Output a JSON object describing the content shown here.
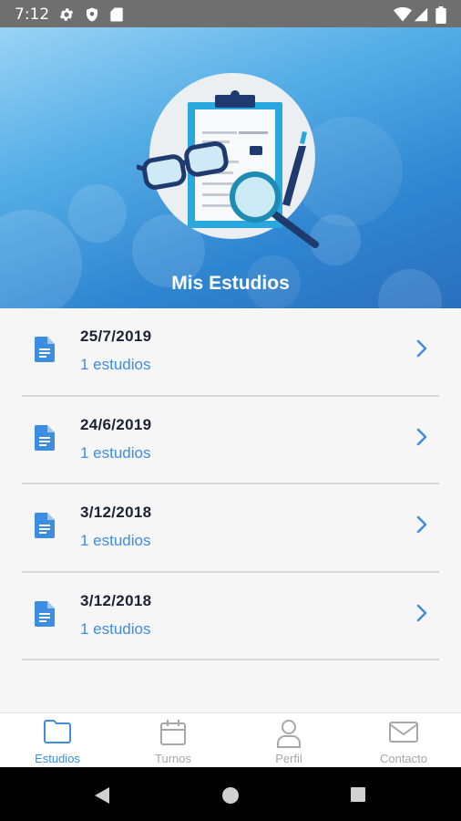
{
  "status_bar": {
    "time": "7:12",
    "left_icons": [
      "settings-icon",
      "shield-icon",
      "sd-card-icon"
    ],
    "right_icons": [
      "wifi-icon",
      "signal-icon",
      "battery-icon"
    ]
  },
  "header": {
    "title": "Mis Estudios",
    "illustration": "clipboard-magnifier-glasses-illustration"
  },
  "studies": [
    {
      "date": "25/7/2019",
      "count": "1 estudios",
      "icon": "document-icon"
    },
    {
      "date": "24/6/2019",
      "count": "1 estudios",
      "icon": "document-icon"
    },
    {
      "date": "3/12/2018",
      "count": "1 estudios",
      "icon": "document-icon"
    },
    {
      "date": "3/12/2018",
      "count": "1 estudios",
      "icon": "document-icon"
    }
  ],
  "bottom_nav": {
    "items": [
      {
        "label": "Estudios",
        "icon": "folder-icon",
        "active": true
      },
      {
        "label": "Turnos",
        "icon": "calendar-icon",
        "active": false
      },
      {
        "label": "Perfil",
        "icon": "user-icon",
        "active": false
      },
      {
        "label": "Contacto",
        "icon": "mail-icon",
        "active": false
      }
    ]
  },
  "colors": {
    "accent": "#3d8de0",
    "header_top": "#9ad3f4",
    "header_bottom": "#2a6fbe",
    "date_text": "#1b2233",
    "inactive_nav": "#a7a7a7"
  }
}
